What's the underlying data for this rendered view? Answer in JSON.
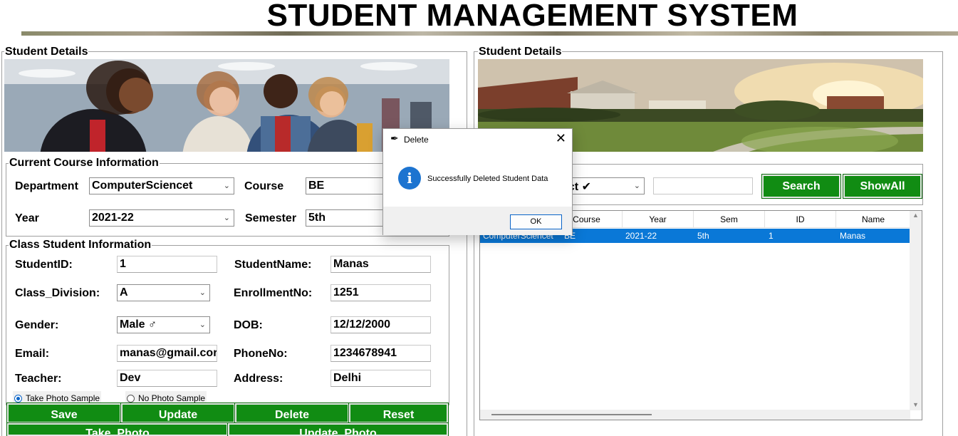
{
  "header": {
    "title": "STUDENT MANAGEMENT SYSTEM"
  },
  "left_panel": {
    "title": "Student Details",
    "course_info": {
      "title": "Current Course Information",
      "department_label": "Department",
      "department_value": "ComputerSciencet",
      "course_label": "Course",
      "course_value": "BE",
      "year_label": "Year",
      "year_value": "2021-22",
      "semester_label": "Semester",
      "semester_value": "5th"
    },
    "class_info": {
      "title": "Class Student Information",
      "student_id_label": "StudentID:",
      "student_id_value": "1",
      "student_name_label": "StudentName:",
      "student_name_value": "Manas",
      "class_division_label": "Class_Division:",
      "class_division_value": "A",
      "enrollment_label": "EnrollmentNo:",
      "enrollment_value": "1251",
      "gender_label": "Gender:",
      "gender_value": "Male ♂",
      "dob_label": "DOB:",
      "dob_value": "12/12/2000",
      "email_label": "Email:",
      "email_value": "manas@gmail.cor",
      "phone_label": "PhoneNo:",
      "phone_value": "1234678941",
      "teacher_label": "Teacher:",
      "teacher_value": "Dev",
      "address_label": "Address:",
      "address_value": "Delhi",
      "radio_take_photo": "Take Photo Sample",
      "radio_no_photo": "No Photo Sample",
      "radio_selected": "take_photo"
    },
    "buttons": {
      "save": "Save",
      "update": "Update",
      "delete": "Delete",
      "reset": "Reset",
      "take_photo": "Take_Photo",
      "update_photo": "Update_Photo"
    }
  },
  "right_panel": {
    "title": "Student Details",
    "search": {
      "combo_value": "ect ✔",
      "input_value": "",
      "search_button": "Search",
      "showall_button": "ShowAll"
    },
    "table": {
      "columns": [
        "Course",
        "Year",
        "Sem",
        "ID",
        "Name"
      ],
      "rows": [
        {
          "department": "ComputerSciencet",
          "course": "BE",
          "year": "2021-22",
          "sem": "5th",
          "id": "1",
          "name": "Manas"
        }
      ]
    }
  },
  "dialog": {
    "title": "Delete",
    "message": "Successfully Deleted Student Data",
    "ok_label": "OK"
  },
  "colors": {
    "button_green": "#118c13",
    "selection_blue": "#0a78d7",
    "info_blue": "#1d74d0"
  }
}
